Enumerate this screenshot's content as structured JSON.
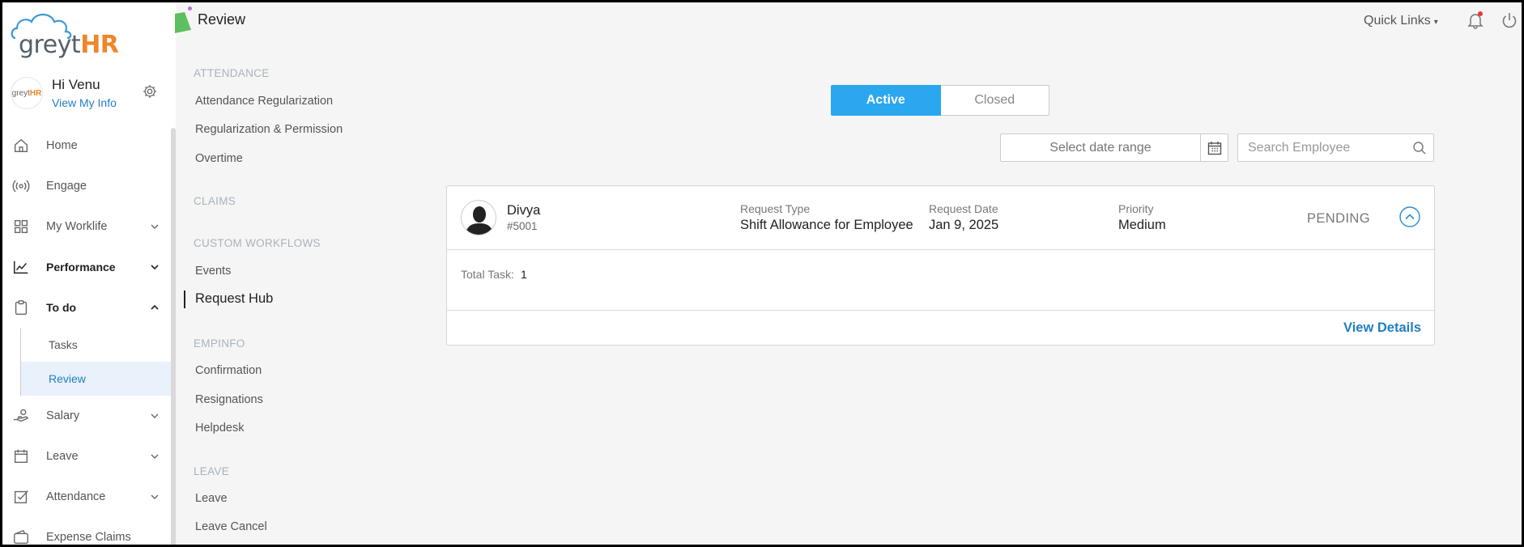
{
  "app": {
    "logo_grey": "greyt",
    "logo_orange": "HR"
  },
  "user": {
    "greeting": "Hi Venu",
    "link": "View My Info",
    "avatar_grey": "greyt",
    "avatar_orange": "HR"
  },
  "nav": {
    "items": [
      {
        "label": "Home",
        "icon": "home-icon"
      },
      {
        "label": "Engage",
        "icon": "broadcast-icon"
      },
      {
        "label": "My Worklife",
        "icon": "grid-icon"
      },
      {
        "label": "Performance",
        "icon": "chart-icon"
      },
      {
        "label": "To do",
        "icon": "clipboard-icon"
      },
      {
        "label": "Salary",
        "icon": "hand-coin-icon"
      },
      {
        "label": "Leave",
        "icon": "calendar-icon"
      },
      {
        "label": "Attendance",
        "icon": "check-square-icon"
      },
      {
        "label": "Expense Claims",
        "icon": "wallet-icon"
      }
    ],
    "todo_sub": [
      "Tasks",
      "Review"
    ]
  },
  "header": {
    "title": "Review",
    "quick_links": "Quick Links"
  },
  "menu": {
    "groups": [
      "ATTENDANCE",
      "CLAIMS",
      "CUSTOM WORKFLOWS",
      "EMPINFO",
      "LEAVE"
    ],
    "attendance": [
      "Attendance Regularization",
      "Regularization & Permission",
      "Overtime"
    ],
    "custom": [
      "Events",
      "Request Hub"
    ],
    "empinfo": [
      "Confirmation",
      "Resignations",
      "Helpdesk"
    ],
    "leave": [
      "Leave",
      "Leave Cancel"
    ]
  },
  "filters": {
    "active": "Active",
    "closed": "Closed",
    "date_placeholder": "Select date range",
    "search_placeholder": "Search Employee"
  },
  "request": {
    "name": "Divya",
    "emp_id": "#5001",
    "type_label": "Request Type",
    "type_value": "Shift Allowance for Employee",
    "date_label": "Request Date",
    "date_value": "Jan 9, 2025",
    "priority_label": "Priority",
    "priority_value": "Medium",
    "status": "PENDING",
    "total_task_label": "Total Task:",
    "total_task_value": "1",
    "view_details": "View Details"
  },
  "colors": {
    "accent": "#2aa7ee",
    "link": "#1f7fc1",
    "brand_orange": "#f0862a"
  }
}
